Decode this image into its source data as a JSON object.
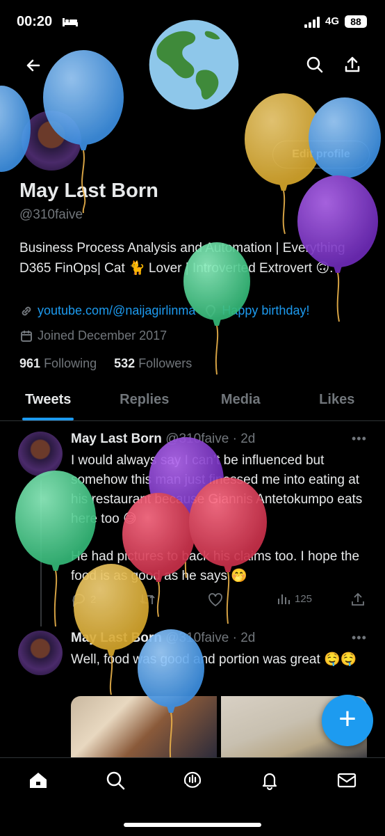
{
  "status_bar": {
    "time": "00:20",
    "network": "4G",
    "battery": "88"
  },
  "profile": {
    "name": "May Last Born",
    "handle": "@310faive",
    "edit_label": "Edit profile",
    "bio": "Business Process Analysis and Automation | Everything D365 FinOps| Cat 🐈 Lover | Introverted Extrovert 🙃.",
    "link": "youtube.com/@naijagirlinma",
    "location": "Happy birthday!",
    "joined": "Joined December 2017",
    "following_count": "961",
    "following_label": "Following",
    "followers_count": "532",
    "followers_label": "Followers"
  },
  "tabs": [
    {
      "label": "Tweets",
      "active": true
    },
    {
      "label": "Replies",
      "active": false
    },
    {
      "label": "Media",
      "active": false
    },
    {
      "label": "Likes",
      "active": false
    }
  ],
  "tweets": [
    {
      "name": "May Last Born",
      "handle": "@310faive",
      "time": "· 2d",
      "text": "I would always say I can’t be influenced but somehow this man just finessed me into eating at his restaurant because Giannis Antetokumpo eats here too 😅",
      "text2": "He had pictures to back his claims too. I hope the food is as good as he says 🤭",
      "replies": "2",
      "views": "125"
    },
    {
      "name": "May Last Born",
      "handle": "@310faive",
      "time": "· 2d",
      "text": "Well, food was good and portion was great 🤤🤤"
    }
  ],
  "colors": {
    "accent": "#1d9bf0",
    "background": "#000000",
    "muted": "#71767b"
  },
  "icons": [
    "back-arrow-icon",
    "search-icon",
    "share-icon",
    "link-icon",
    "location-icon",
    "calendar-icon",
    "home-icon",
    "explore-icon",
    "spaces-icon",
    "bell-icon",
    "mail-icon",
    "compose-icon"
  ]
}
